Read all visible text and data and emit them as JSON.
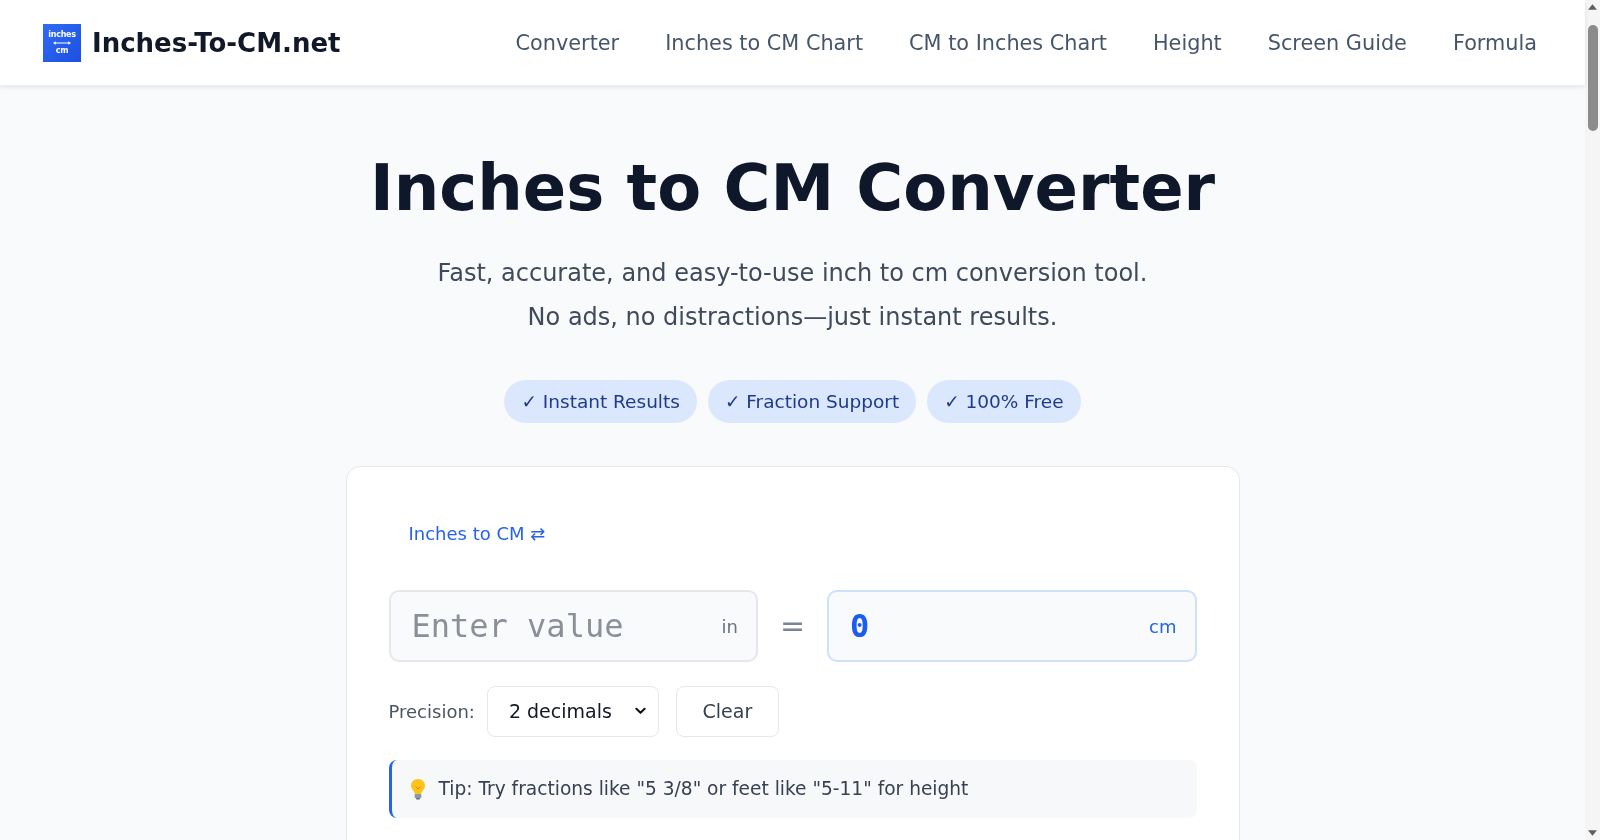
{
  "header": {
    "logo": {
      "top": "inches",
      "bottom": "cm"
    },
    "brand": "Inches-To-CM.net",
    "nav": [
      {
        "label": "Converter"
      },
      {
        "label": "Inches to CM Chart"
      },
      {
        "label": "CM to Inches Chart"
      },
      {
        "label": "Height"
      },
      {
        "label": "Screen Guide"
      },
      {
        "label": "Formula"
      }
    ]
  },
  "hero": {
    "title": "Inches to CM Converter",
    "subtitle_lines": [
      "Fast, accurate, and easy-to-use inch to cm conversion tool.",
      "No ads, no distractions—just instant results."
    ],
    "badges": [
      {
        "label": "✓ Instant Results"
      },
      {
        "label": "✓ Fraction Support"
      },
      {
        "label": "✓ 100% Free"
      }
    ]
  },
  "converter": {
    "direction_toggle": "Inches to CM ⇄",
    "input": {
      "placeholder": "Enter value",
      "unit": "in"
    },
    "equals": "=",
    "output": {
      "value": "0",
      "unit": "cm"
    },
    "precision": {
      "label": "Precision:",
      "value": "2 decimals"
    },
    "clear_button": "Clear",
    "tip": {
      "text": "Tip: Try fractions like \"5 3/8\" or feet like \"5-11\" for height"
    }
  }
}
